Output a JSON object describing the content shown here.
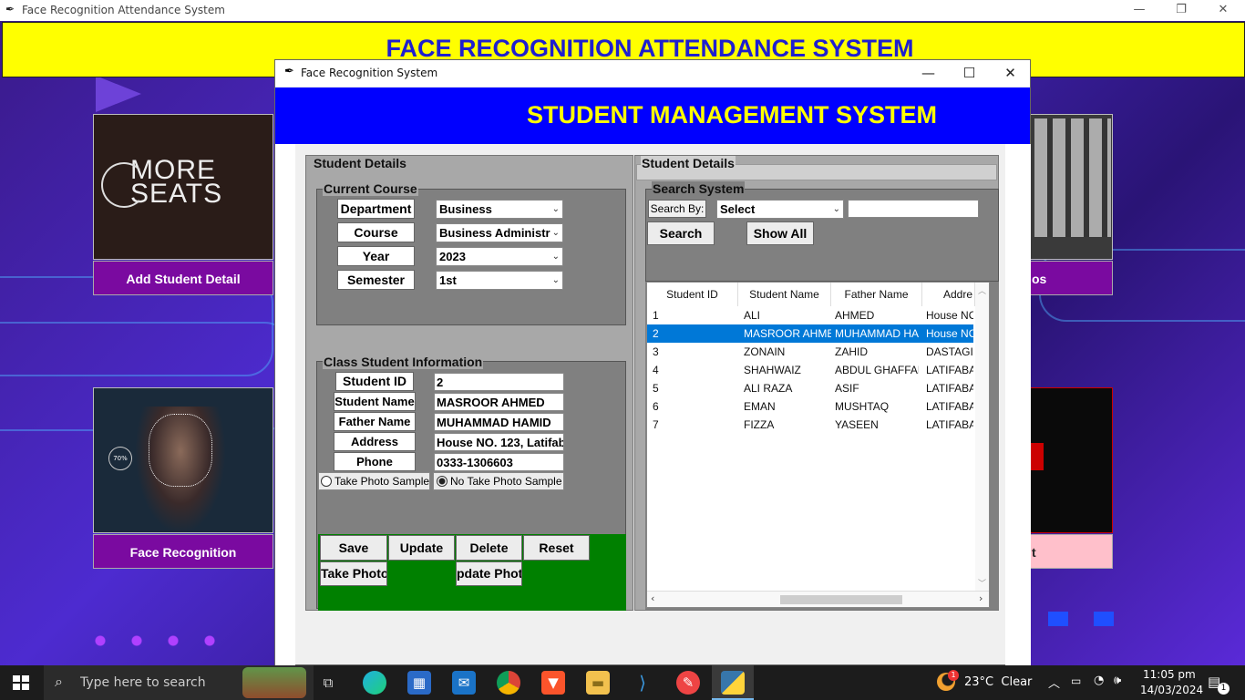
{
  "main_window": {
    "title": "Face Recognition Attendance System",
    "banner": "FACE RECOGNITION ATTENDANCE SYSTEM"
  },
  "tiles": [
    {
      "label": "Add Student Detail",
      "image_text": "MORE SEATS"
    },
    {
      "label": "Face Recognition",
      "image_text": "70%"
    },
    {
      "label": "os"
    },
    {
      "label": "t"
    }
  ],
  "dialog": {
    "title": "Face Recognition System",
    "header": "STUDENT MANAGEMENT SYSTEM",
    "left": {
      "frame_label": "Student Details",
      "course": {
        "label": "Current Course",
        "fields": [
          {
            "label": "Department",
            "value": "Business"
          },
          {
            "label": "Course",
            "value": "Business Administr"
          },
          {
            "label": "Year",
            "value": "2023"
          },
          {
            "label": "Semester",
            "value": "1st"
          }
        ]
      },
      "info": {
        "label": "Class Student Information",
        "fields": [
          {
            "label": "Student ID",
            "value": "2"
          },
          {
            "label": "Student Name",
            "value": "MASROOR AHMED"
          },
          {
            "label": "Father Name",
            "value": "MUHAMMAD HAMID"
          },
          {
            "label": "Address",
            "value": "House NO. 123, Latifab"
          },
          {
            "label": "Phone",
            "value": "0333-1306603"
          }
        ],
        "radio1": "Take Photo Sample",
        "radio2": "No Take Photo Sample",
        "selected_radio": 2
      },
      "buttons": {
        "save": "Save",
        "update": "Update",
        "delete": "Delete",
        "reset": "Reset",
        "take_photo": "Take Photo",
        "update_photo": "pdate Phot"
      }
    },
    "right": {
      "frame_label": "Student Details",
      "search": {
        "label": "Search System",
        "by_label": "Search By:",
        "by_value": "Select",
        "input": "",
        "search_btn": "Search",
        "show_all_btn": "Show All"
      },
      "table": {
        "columns": [
          "Student ID",
          "Student Name",
          "Father Name",
          "Addre"
        ],
        "rows": [
          {
            "id": "1",
            "name": "ALI",
            "father": "AHMED",
            "address": "House NO"
          },
          {
            "id": "2",
            "name": "MASROOR AHME",
            "father": "MUHAMMAD HA",
            "address": "House NO"
          },
          {
            "id": "3",
            "name": "ZONAIN",
            "father": "ZAHID",
            "address": "DASTAGIR"
          },
          {
            "id": "4",
            "name": "SHAHWAIZ",
            "father": "ABDUL GHAFFAR",
            "address": "LATIFABAI"
          },
          {
            "id": "5",
            "name": "ALI RAZA",
            "father": "ASIF",
            "address": "LATIFABAI"
          },
          {
            "id": "6",
            "name": "EMAN",
            "father": "MUSHTAQ",
            "address": "LATIFABAI"
          },
          {
            "id": "7",
            "name": "FIZZA",
            "father": "YASEEN",
            "address": "LATIFABAI"
          }
        ],
        "selected_row": 2
      }
    }
  },
  "taskbar": {
    "search_placeholder": "Type here to search",
    "weather": "23°C  Clear",
    "weather_badge": "1",
    "time": "11:05 pm",
    "date": "14/03/2024",
    "notif_count": "1"
  },
  "colors": {
    "banner": "#ffff00",
    "banner_text": "#1f1fcf",
    "header": "#0000ff",
    "header_text": "#ffff00",
    "tile_label": "#7a0aa0",
    "button_area": "#008000",
    "selection": "#0078d7"
  }
}
